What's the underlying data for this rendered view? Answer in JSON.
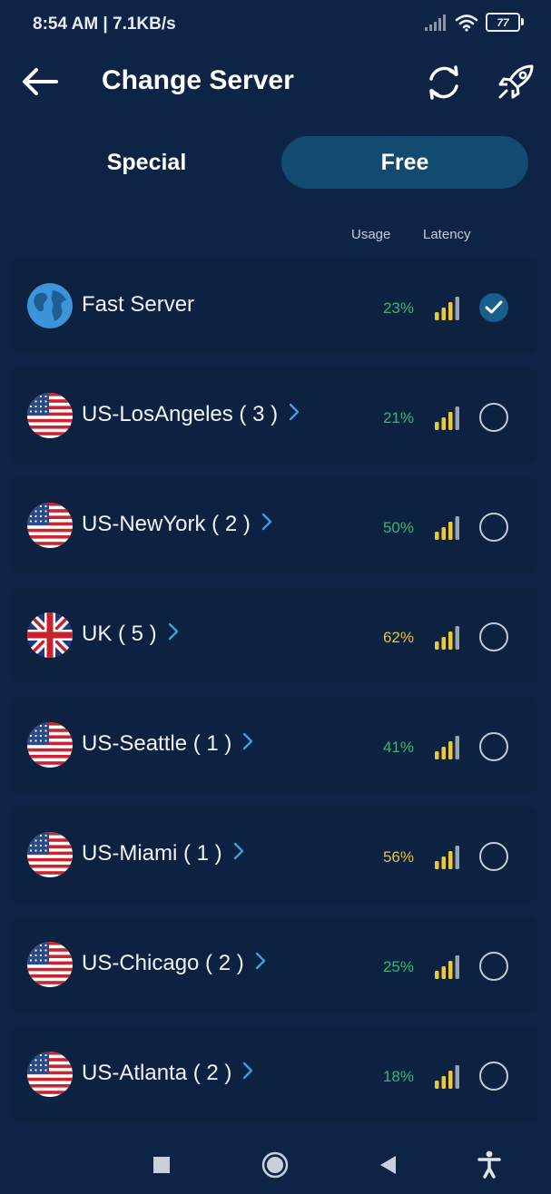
{
  "status_bar": {
    "time": "8:54 AM | 7.1KB/s",
    "battery": "77",
    "icons": [
      "signal-icon",
      "wifi-icon",
      "battery-icon"
    ]
  },
  "header": {
    "title": "Change Server",
    "icons": [
      "back-arrow-icon",
      "refresh-icon",
      "rocket-icon"
    ]
  },
  "tabs": [
    {
      "label": "Special",
      "selected": false
    },
    {
      "label": "Free",
      "selected": true
    }
  ],
  "columns": {
    "usage": "Usage",
    "latency": "Latency"
  },
  "colors": {
    "background": "#0d2447",
    "row": "#0c2240",
    "tab_selected": "#124a70",
    "usage_green": "#37b578",
    "usage_yellow": "#e3c534",
    "signal_bar": "#e9c93a",
    "check_bg": "#1a5e8a"
  },
  "servers": [
    {
      "name": "Fast Server",
      "flag": "globe",
      "usage": "23%",
      "usage_color": "green",
      "has_chevron": false,
      "selected": true
    },
    {
      "name": "US-LosAngeles ( 3 )",
      "flag": "us",
      "usage": "21%",
      "usage_color": "green",
      "has_chevron": true,
      "selected": false
    },
    {
      "name": "US-NewYork ( 2 )",
      "flag": "us",
      "usage": "50%",
      "usage_color": "green",
      "has_chevron": true,
      "selected": false
    },
    {
      "name": "UK ( 5 )",
      "flag": "uk",
      "usage": "62%",
      "usage_color": "yellow",
      "has_chevron": true,
      "selected": false
    },
    {
      "name": "US-Seattle ( 1 )",
      "flag": "us",
      "usage": "41%",
      "usage_color": "green",
      "has_chevron": true,
      "selected": false
    },
    {
      "name": "US-Miami ( 1 )",
      "flag": "us",
      "usage": "56%",
      "usage_color": "yellow",
      "has_chevron": true,
      "selected": false
    },
    {
      "name": "US-Chicago ( 2 )",
      "flag": "us",
      "usage": "25%",
      "usage_color": "green",
      "has_chevron": true,
      "selected": false
    },
    {
      "name": "US-Atlanta ( 2 )",
      "flag": "us",
      "usage": "18%",
      "usage_color": "green",
      "has_chevron": true,
      "selected": false
    }
  ],
  "nav_bar": {
    "icons": [
      "recents-square-icon",
      "home-circle-icon",
      "back-triangle-icon",
      "accessibility-icon"
    ]
  }
}
